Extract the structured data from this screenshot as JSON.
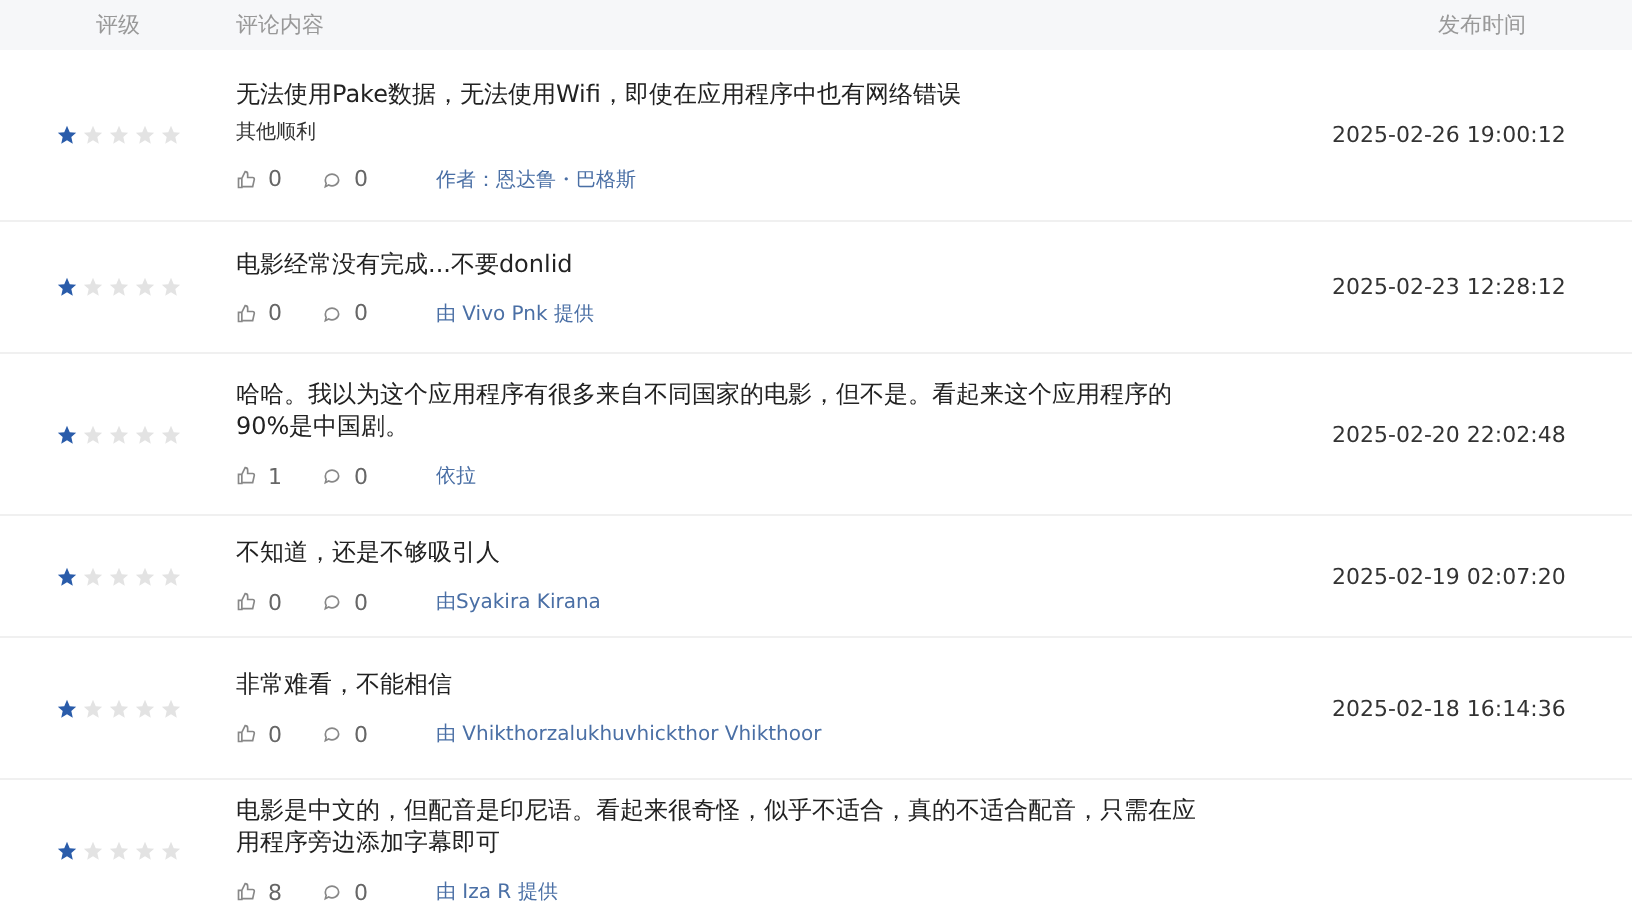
{
  "table": {
    "columns": [
      "评级",
      "评论内容",
      "发布时间"
    ],
    "rows": [
      {
        "stars": 1,
        "text": "无法使用Pake数据，无法使用Wifi，即使在应用程序中也有网络错误",
        "subtext": "其他顺利",
        "likes": "0",
        "comments": "0",
        "author": "作者：恩达鲁・巴格斯",
        "time": "2025-02-26 19:00:12"
      },
      {
        "stars": 1,
        "text": "电影经常没有完成...不要donlid",
        "likes": "0",
        "comments": "0",
        "author": "由 Vivo Pnk 提供",
        "time": "2025-02-23 12:28:12"
      },
      {
        "stars": 1,
        "text": "哈哈。我以为这个应用程序有很多来自不同国家的电影，但不是。看起来这个应用程序的90%是中国剧。",
        "likes": "1",
        "comments": "0",
        "author": "依拉",
        "time": "2025-02-20 22:02:48"
      },
      {
        "stars": 1,
        "text": "不知道，还是不够吸引人",
        "likes": "0",
        "comments": "0",
        "author": "由Syakira Kirana",
        "time": "2025-02-19 02:07:20"
      },
      {
        "stars": 1,
        "text": "非常难看，不能相信",
        "likes": "0",
        "comments": "0",
        "author": "由 Vhikthorzalukhuvhickthor Vhikthoor",
        "time": "2025-02-18 16:14:36"
      },
      {
        "stars": 1,
        "text": "电影是中文的，但配音是印尼语。看起来很奇怪，似乎不适合，真的不适合配音，只需在应用程序旁边添加字幕即可",
        "likes": "8",
        "comments": "0",
        "author": "由 Iza R 提供"
      }
    ]
  }
}
